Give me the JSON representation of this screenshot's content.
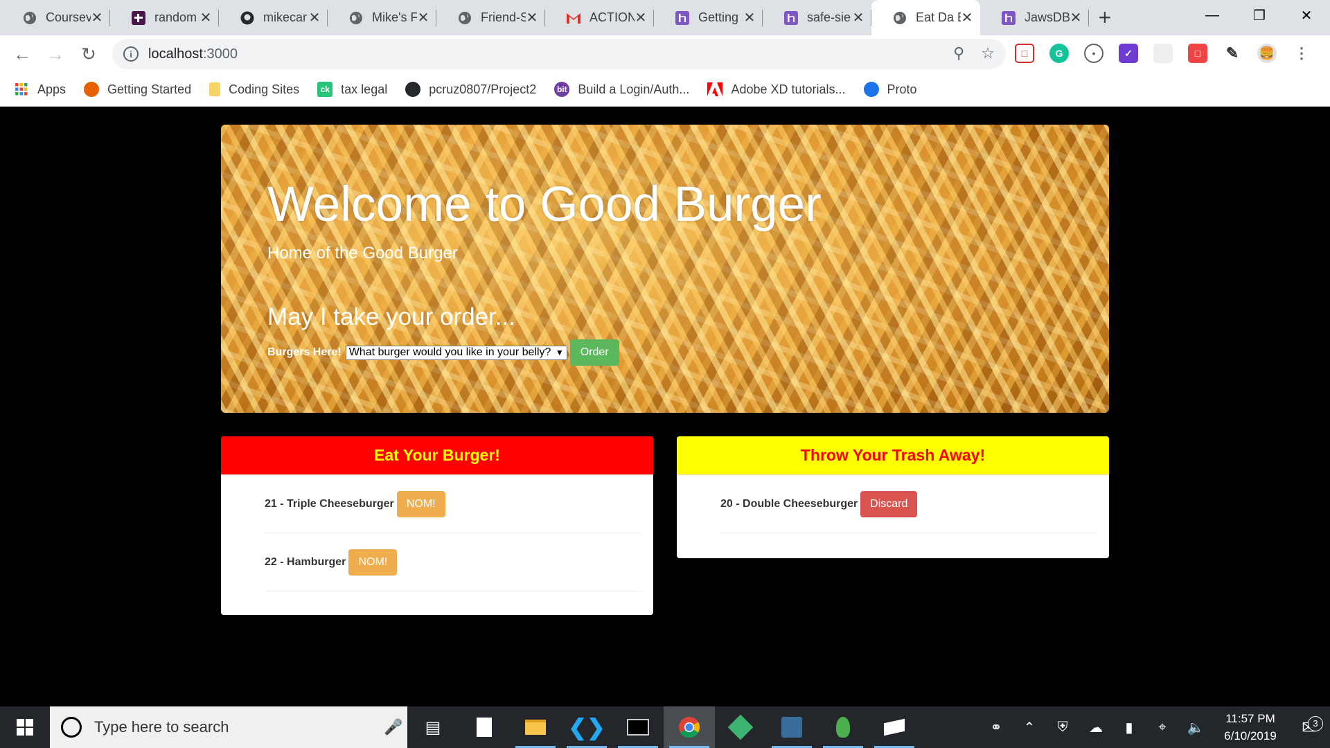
{
  "browser": {
    "tabs": [
      {
        "title": "Coursev",
        "icon": "globe-icon"
      },
      {
        "title": "random",
        "icon": "slack-icon"
      },
      {
        "title": "mikecar",
        "icon": "github-icon"
      },
      {
        "title": "Mike's F",
        "icon": "globe-icon"
      },
      {
        "title": "Friend-S",
        "icon": "globe-icon"
      },
      {
        "title": "ACTION",
        "icon": "gmail-icon"
      },
      {
        "title": "Getting",
        "icon": "heroku-icon"
      },
      {
        "title": "safe-sie",
        "icon": "heroku-icon"
      },
      {
        "title": "Eat Da B",
        "icon": "globe-icon",
        "active": true
      },
      {
        "title": "JawsDB",
        "icon": "heroku-icon"
      }
    ],
    "address": {
      "host": "localhost",
      "port": ":3000"
    },
    "bookmarks": [
      {
        "label": "Apps",
        "icon": "apps-grid-icon",
        "color": "#ea4335"
      },
      {
        "label": "Getting Started",
        "icon": "firefox-icon",
        "color": "#e66000"
      },
      {
        "label": "Coding Sites",
        "icon": "folder-icon",
        "color": "#f6d365"
      },
      {
        "label": "tax legal",
        "icon": "ck-icon",
        "color": "#29c47a",
        "glyph": "ck"
      },
      {
        "label": "pcruz0807/Project2",
        "icon": "github-icon",
        "color": "#24292e"
      },
      {
        "label": "Build a Login/Auth...",
        "icon": "bit-icon",
        "color": "#6b3fa0",
        "glyph": "bit"
      },
      {
        "label": "Adobe XD tutorials...",
        "icon": "adobe-icon",
        "color": "#ff0000"
      },
      {
        "label": "Proto",
        "icon": "proto-icon",
        "color": "#1a73e8"
      }
    ]
  },
  "jumbotron": {
    "title": "Welcome to Good Burger",
    "subtitle": "Home of the Good Burger",
    "order_prompt": "May I take your order...",
    "form_label": "Burgers Here!",
    "select_value": "What burger would you like in your belly?",
    "order_button": "Order"
  },
  "eat_panel": {
    "heading": "Eat Your Burger!",
    "items": [
      {
        "name": "21 - Triple Cheeseburger",
        "button": "NOM!"
      },
      {
        "name": "22 - Hamburger",
        "button": "NOM!"
      }
    ]
  },
  "trash_panel": {
    "heading": "Throw Your Trash Away!",
    "items": [
      {
        "name": "20 - Double Cheeseburger",
        "button": "Discard"
      }
    ]
  },
  "taskbar": {
    "search_placeholder": "Type here to search",
    "time": "11:57 PM",
    "date": "6/10/2019",
    "notification_count": "3"
  }
}
